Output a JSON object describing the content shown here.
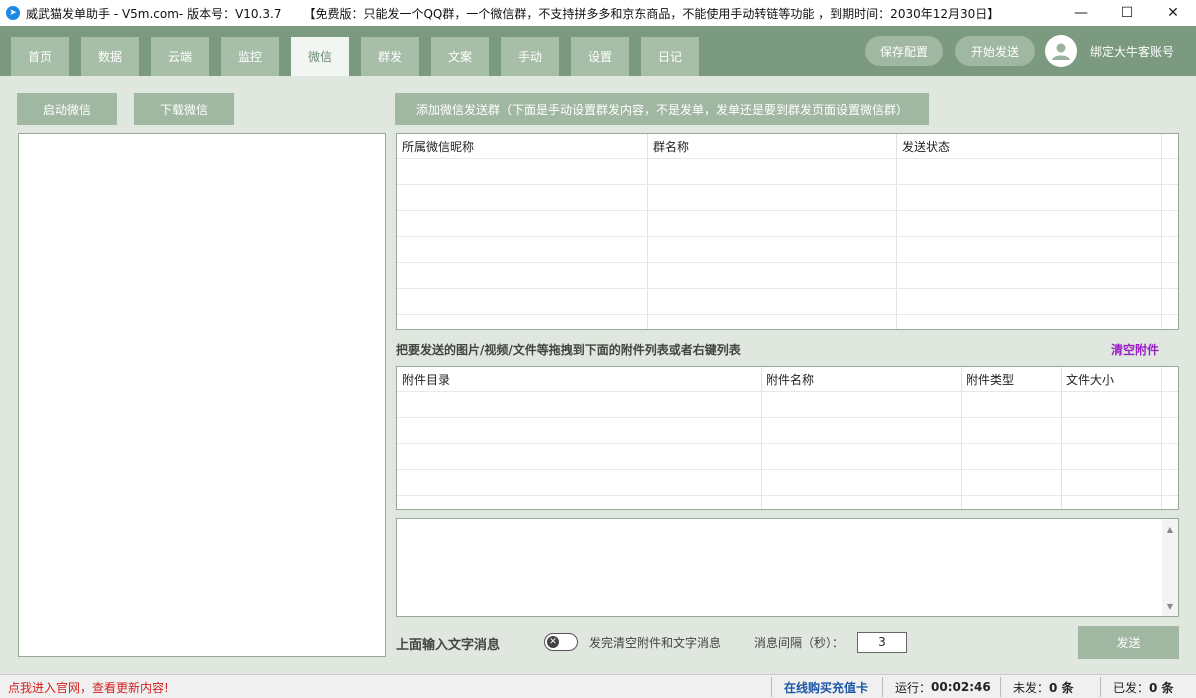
{
  "window": {
    "title": "威武猫发单助手 - V5m.com- 版本号：V10.3.7",
    "notice": "【免费版：只能发一个QQ群，一个微信群，不支持拼多多和京东商品，不能使用手动转链等功能 ，到期时间：2030年12月30日】",
    "minimize": "—",
    "maximize": "☐",
    "close": "✕"
  },
  "nav": {
    "tabs": [
      "首页",
      "数据",
      "云端",
      "监控",
      "微信",
      "群发",
      "文案",
      "手动",
      "设置",
      "日记"
    ],
    "active_tab": "微信",
    "save_config": "保存配置",
    "start_send": "开始发送",
    "bind_account": "绑定大牛客账号"
  },
  "left": {
    "start_wechat": "启动微信",
    "download_wechat": "下载微信"
  },
  "groups": {
    "add_button": "添加微信发送群（下面是手动设置群发内容，不是发单，发单还是要到群发页面设置微信群）",
    "columns": [
      "所属微信昵称",
      "群名称",
      "发送状态"
    ]
  },
  "attachments": {
    "hint": "把要发送的图片/视频/文件等拖拽到下面的附件列表或者右键列表",
    "clear": "清空附件",
    "columns": [
      "附件目录",
      "附件名称",
      "附件类型",
      "文件大小"
    ]
  },
  "message": {
    "input_label": "上面输入文字消息",
    "clear_after_send": "发完清空附件和文字消息",
    "interval_label": "消息间隔（秒）：",
    "interval_value": "3",
    "send": "发送"
  },
  "status": {
    "website": "点我进入官网，查看更新内容!",
    "buy_card": "在线购买充值卡",
    "running_label": "运行：",
    "running_time": "00:02:46",
    "unsent_label": "未发：",
    "unsent_value": "0 条",
    "sent_label": "已发：",
    "sent_value": "0 条"
  },
  "colors": {
    "nav_bg": "#7b9a80",
    "tab_bg": "#a7bea9",
    "main_bg": "#dfe7df",
    "link_purple": "#9b1fc8",
    "status_red": "#d21f1f",
    "status_blue": "#1c56a8"
  },
  "icons": [
    "telegram-app-icon",
    "user-avatar-icon",
    "x-toggle-icon"
  ]
}
